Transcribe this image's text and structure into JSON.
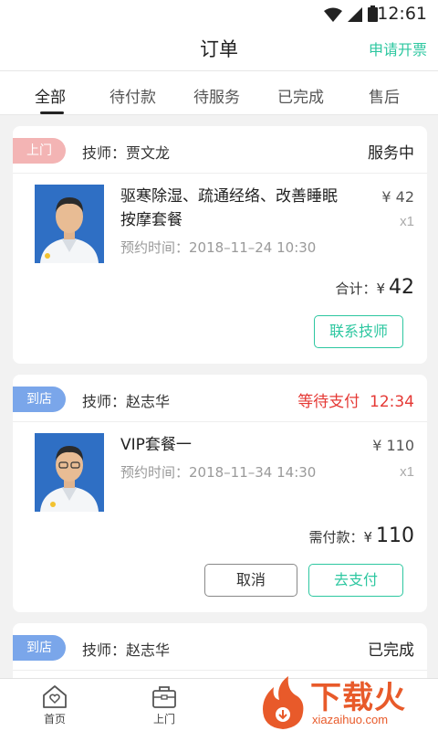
{
  "statusbar": {
    "time": "12:61"
  },
  "header": {
    "title": "订单",
    "invoice_label": "申请开票"
  },
  "tabs": [
    {
      "label": "全部",
      "active": true
    },
    {
      "label": "待付款"
    },
    {
      "label": "待服务"
    },
    {
      "label": "已完成"
    },
    {
      "label": "售后"
    }
  ],
  "orders": [
    {
      "tag": "上门",
      "technician": "技师：贾文龙",
      "status": "服务中",
      "item_name": "驱寒除湿、疏通经络、改善睡眠按摩套餐",
      "price": "¥ 42",
      "qty": "x1",
      "appointment": "预约时间：2018–11–24 10:30",
      "total_label": "合计：",
      "total_currency": "¥",
      "total_amount": "42",
      "button_primary": "联系技师"
    },
    {
      "tag": "到店",
      "technician": "技师：赵志华",
      "status": "等待支付",
      "countdown": "12:34",
      "item_name": "VIP套餐一",
      "price": "¥ 110",
      "qty": "x1",
      "appointment": "预约时间：2018–11–34 14:30",
      "total_label": "需付款：",
      "total_currency": "¥",
      "total_amount": "110",
      "button_secondary": "取消",
      "button_primary": "去支付"
    },
    {
      "tag": "到店",
      "technician": "技师：赵志华",
      "status": "已完成"
    }
  ],
  "bottom_nav": [
    {
      "label": "首页",
      "icon": "home-heart-icon"
    },
    {
      "label": "上门",
      "icon": "medical-bag-icon"
    }
  ],
  "watermark": {
    "text": "下载火",
    "url": "xiazaihuo.com"
  },
  "colors": {
    "accent": "#2dc7a0",
    "alert": "#e53935",
    "tag_home": "#f3b4b4",
    "tag_store": "#7aa6ea",
    "watermark": "#e85a2a"
  }
}
